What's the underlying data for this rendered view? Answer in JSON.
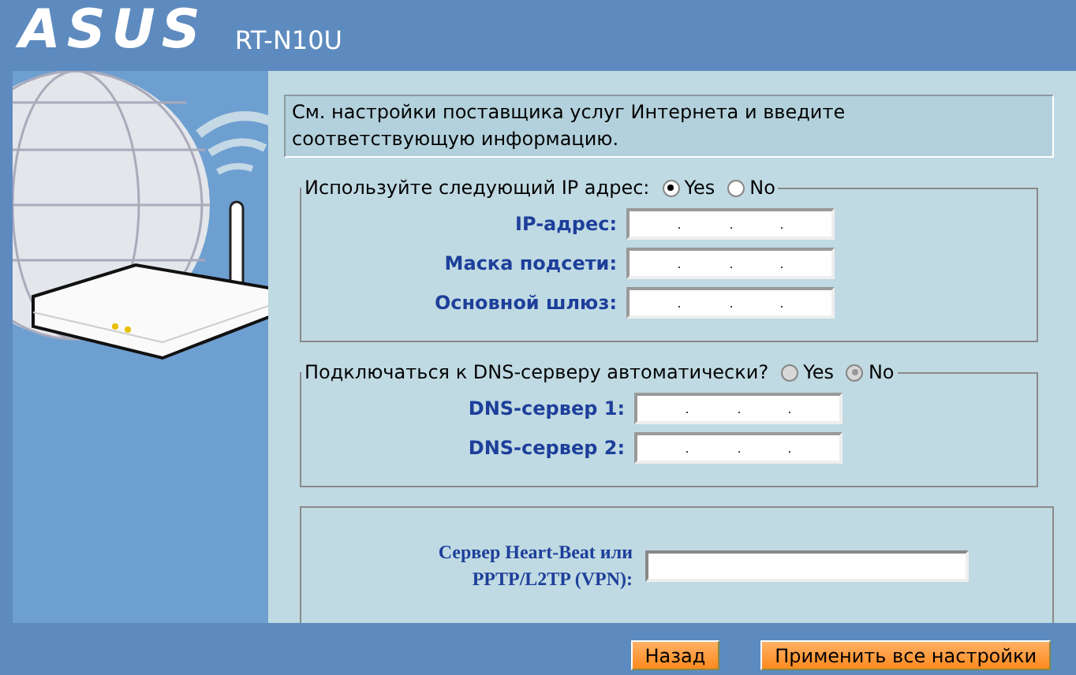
{
  "header": {
    "logo": "ASUS",
    "model": "RT-N10U"
  },
  "intro": "См. настройки поставщика услуг Интернета и введите соответствующую информацию.",
  "ip_group": {
    "legend": "Используйте следующий IP адрес:",
    "disabled": false,
    "options": [
      {
        "label": "Yes",
        "selected": true
      },
      {
        "label": "No",
        "selected": false
      }
    ],
    "fields": [
      {
        "label": "IP-адрес:"
      },
      {
        "label": "Маска подсети:"
      },
      {
        "label": "Основной шлюз:"
      }
    ]
  },
  "dns_group": {
    "legend": "Подключаться к DNS-серверу автоматически?",
    "disabled": true,
    "options": [
      {
        "label": "Yes",
        "selected": false
      },
      {
        "label": "No",
        "selected": true
      }
    ],
    "fields": [
      {
        "label": "DNS-сервер 1:"
      },
      {
        "label": "DNS-сервер 2:"
      }
    ]
  },
  "vpn": {
    "label": "Сервер Heart-Beat или PPTP/L2TP (VPN):"
  },
  "buttons": [
    {
      "label": "Назад"
    },
    {
      "label": "Применить все настройки"
    }
  ]
}
